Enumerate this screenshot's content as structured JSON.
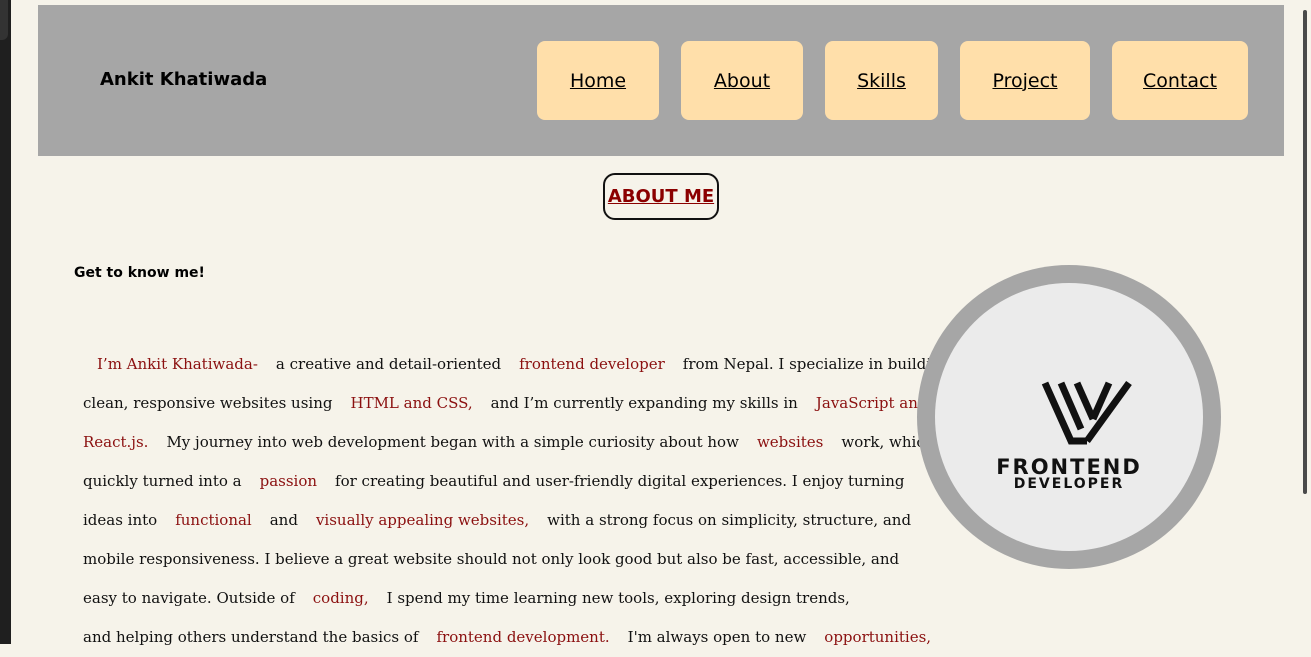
{
  "header": {
    "brand": "Ankit Khatiwada",
    "nav": [
      "Home",
      "About",
      "Skills",
      "Project",
      "Contact"
    ]
  },
  "section": {
    "title": "ABOUT ME",
    "subtitle": "Get to know me!"
  },
  "bio": {
    "l1": [
      "I’m Ankit Khatiwada-",
      "a creative and detail-oriented",
      "frontend developer",
      "from Nepal. I specialize in building"
    ],
    "l2": [
      "clean, responsive websites using",
      "HTML and CSS,",
      "and I’m currently expanding my skills in",
      "JavaScript and"
    ],
    "l3": [
      "React.js.",
      "My journey into web development began with a simple curiosity about how",
      "websites",
      "work, which"
    ],
    "l4": [
      "quickly turned into a",
      "passion",
      "for creating beautiful and user-friendly digital experiences. I enjoy turning"
    ],
    "l5": [
      "ideas into",
      "functional",
      "and",
      "visually appealing websites,",
      "with a strong focus on simplicity, structure, and"
    ],
    "l6": "mobile responsiveness. I believe a great website should not only look good but also be fast, accessible, and",
    "l7": [
      "easy to navigate. Outside of",
      "coding,",
      "I spend my time learning new tools, exploring design trends,"
    ],
    "l8": [
      "and helping others understand the basics of",
      "frontend development.",
      "I'm always open to new",
      "opportunities,"
    ]
  },
  "logo": {
    "icon": "frontend-developer-logo-icon",
    "line1": "FRONTEND",
    "line2": "DEVELOPER"
  },
  "colors": {
    "header_bg": "#a6a6a6",
    "nav_bg": "#ffdfaa",
    "highlight": "#8b1010",
    "page_bg": "#f6f3ea"
  }
}
